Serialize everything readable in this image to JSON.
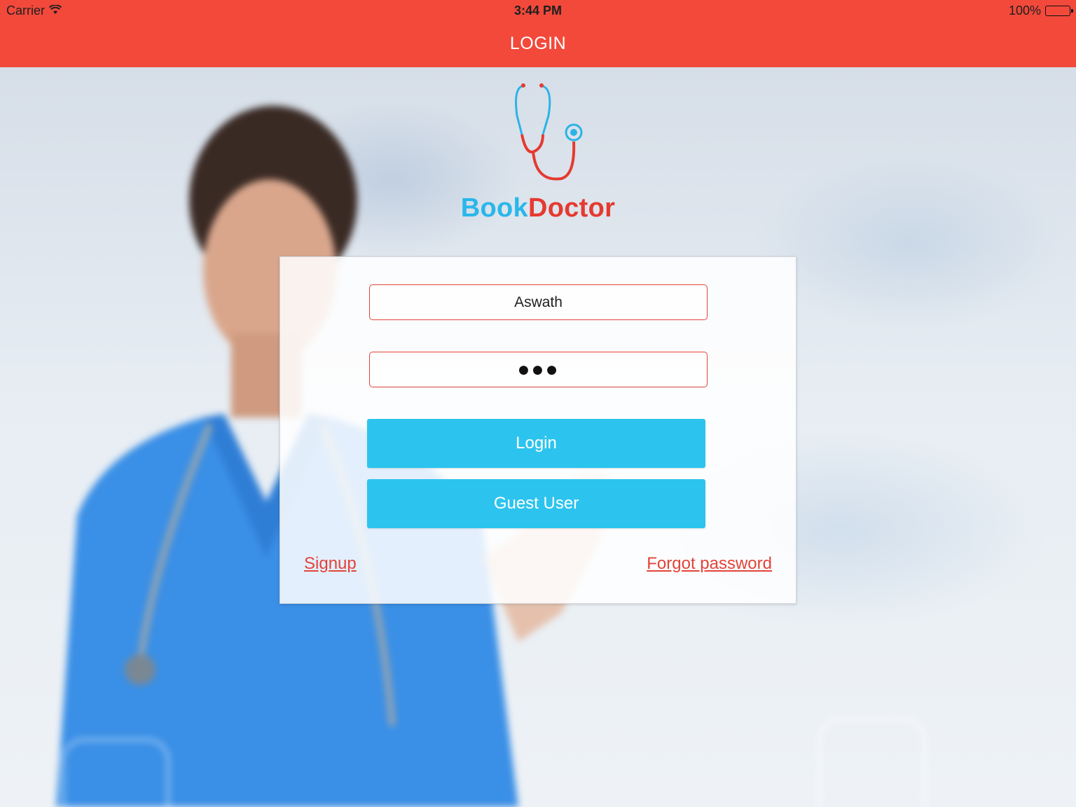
{
  "status_bar": {
    "carrier": "Carrier",
    "time": "3:44 PM",
    "battery": "100%"
  },
  "nav": {
    "title": "LOGIN"
  },
  "brand": {
    "part1": "Book",
    "part2": "Doctor"
  },
  "form": {
    "username_value": "Aswath",
    "password_value": "●●●",
    "login_label": "Login",
    "guest_label": "Guest User",
    "signup_label": "Signup",
    "forgot_label": "Forgot password"
  },
  "colors": {
    "nav_bar": "#f2493b",
    "brand_blue": "#29b7ea",
    "brand_red": "#e53a30",
    "button": "#2cc4ee",
    "field_border": "#e2443a"
  },
  "icons": {
    "logo": "stethoscope-icon",
    "wifi": "wifi-icon",
    "battery": "battery-icon"
  }
}
